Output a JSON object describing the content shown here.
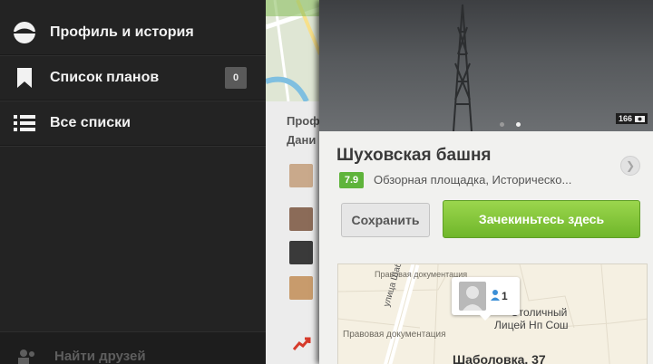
{
  "sidebar": {
    "items": [
      {
        "label": "Профиль и история",
        "icon": "profile-icon"
      },
      {
        "label": "Список планов",
        "icon": "bookmark-icon",
        "badge": "0"
      },
      {
        "label": "Все списки",
        "icon": "list-icon"
      }
    ],
    "bottom": {
      "label": "Найти друзей",
      "icon": "add-friends-icon"
    }
  },
  "middle": {
    "text_line1": "Проф",
    "text_line2": "Дани"
  },
  "venue": {
    "photo_count": "166",
    "name": "Шуховская башня",
    "rating": "7.9",
    "category": "Обзорная площадка, Историческо...",
    "save_label": "Сохранить",
    "checkin_label": "Зачекиньтесь здесь",
    "rating_color": "#5fb43b",
    "checkin_color": "#7ec238"
  },
  "map": {
    "street_label": "улица Шаболовка",
    "street_label2": "Шаболовка",
    "doc_label_top": "Правовая документация",
    "doc_label_bottom": "Правовая документация",
    "poi_line1": "Столичный",
    "poi_line2": "Лицей Нп Сош",
    "pin_count": "1",
    "address": "Шаболовка, 37"
  }
}
